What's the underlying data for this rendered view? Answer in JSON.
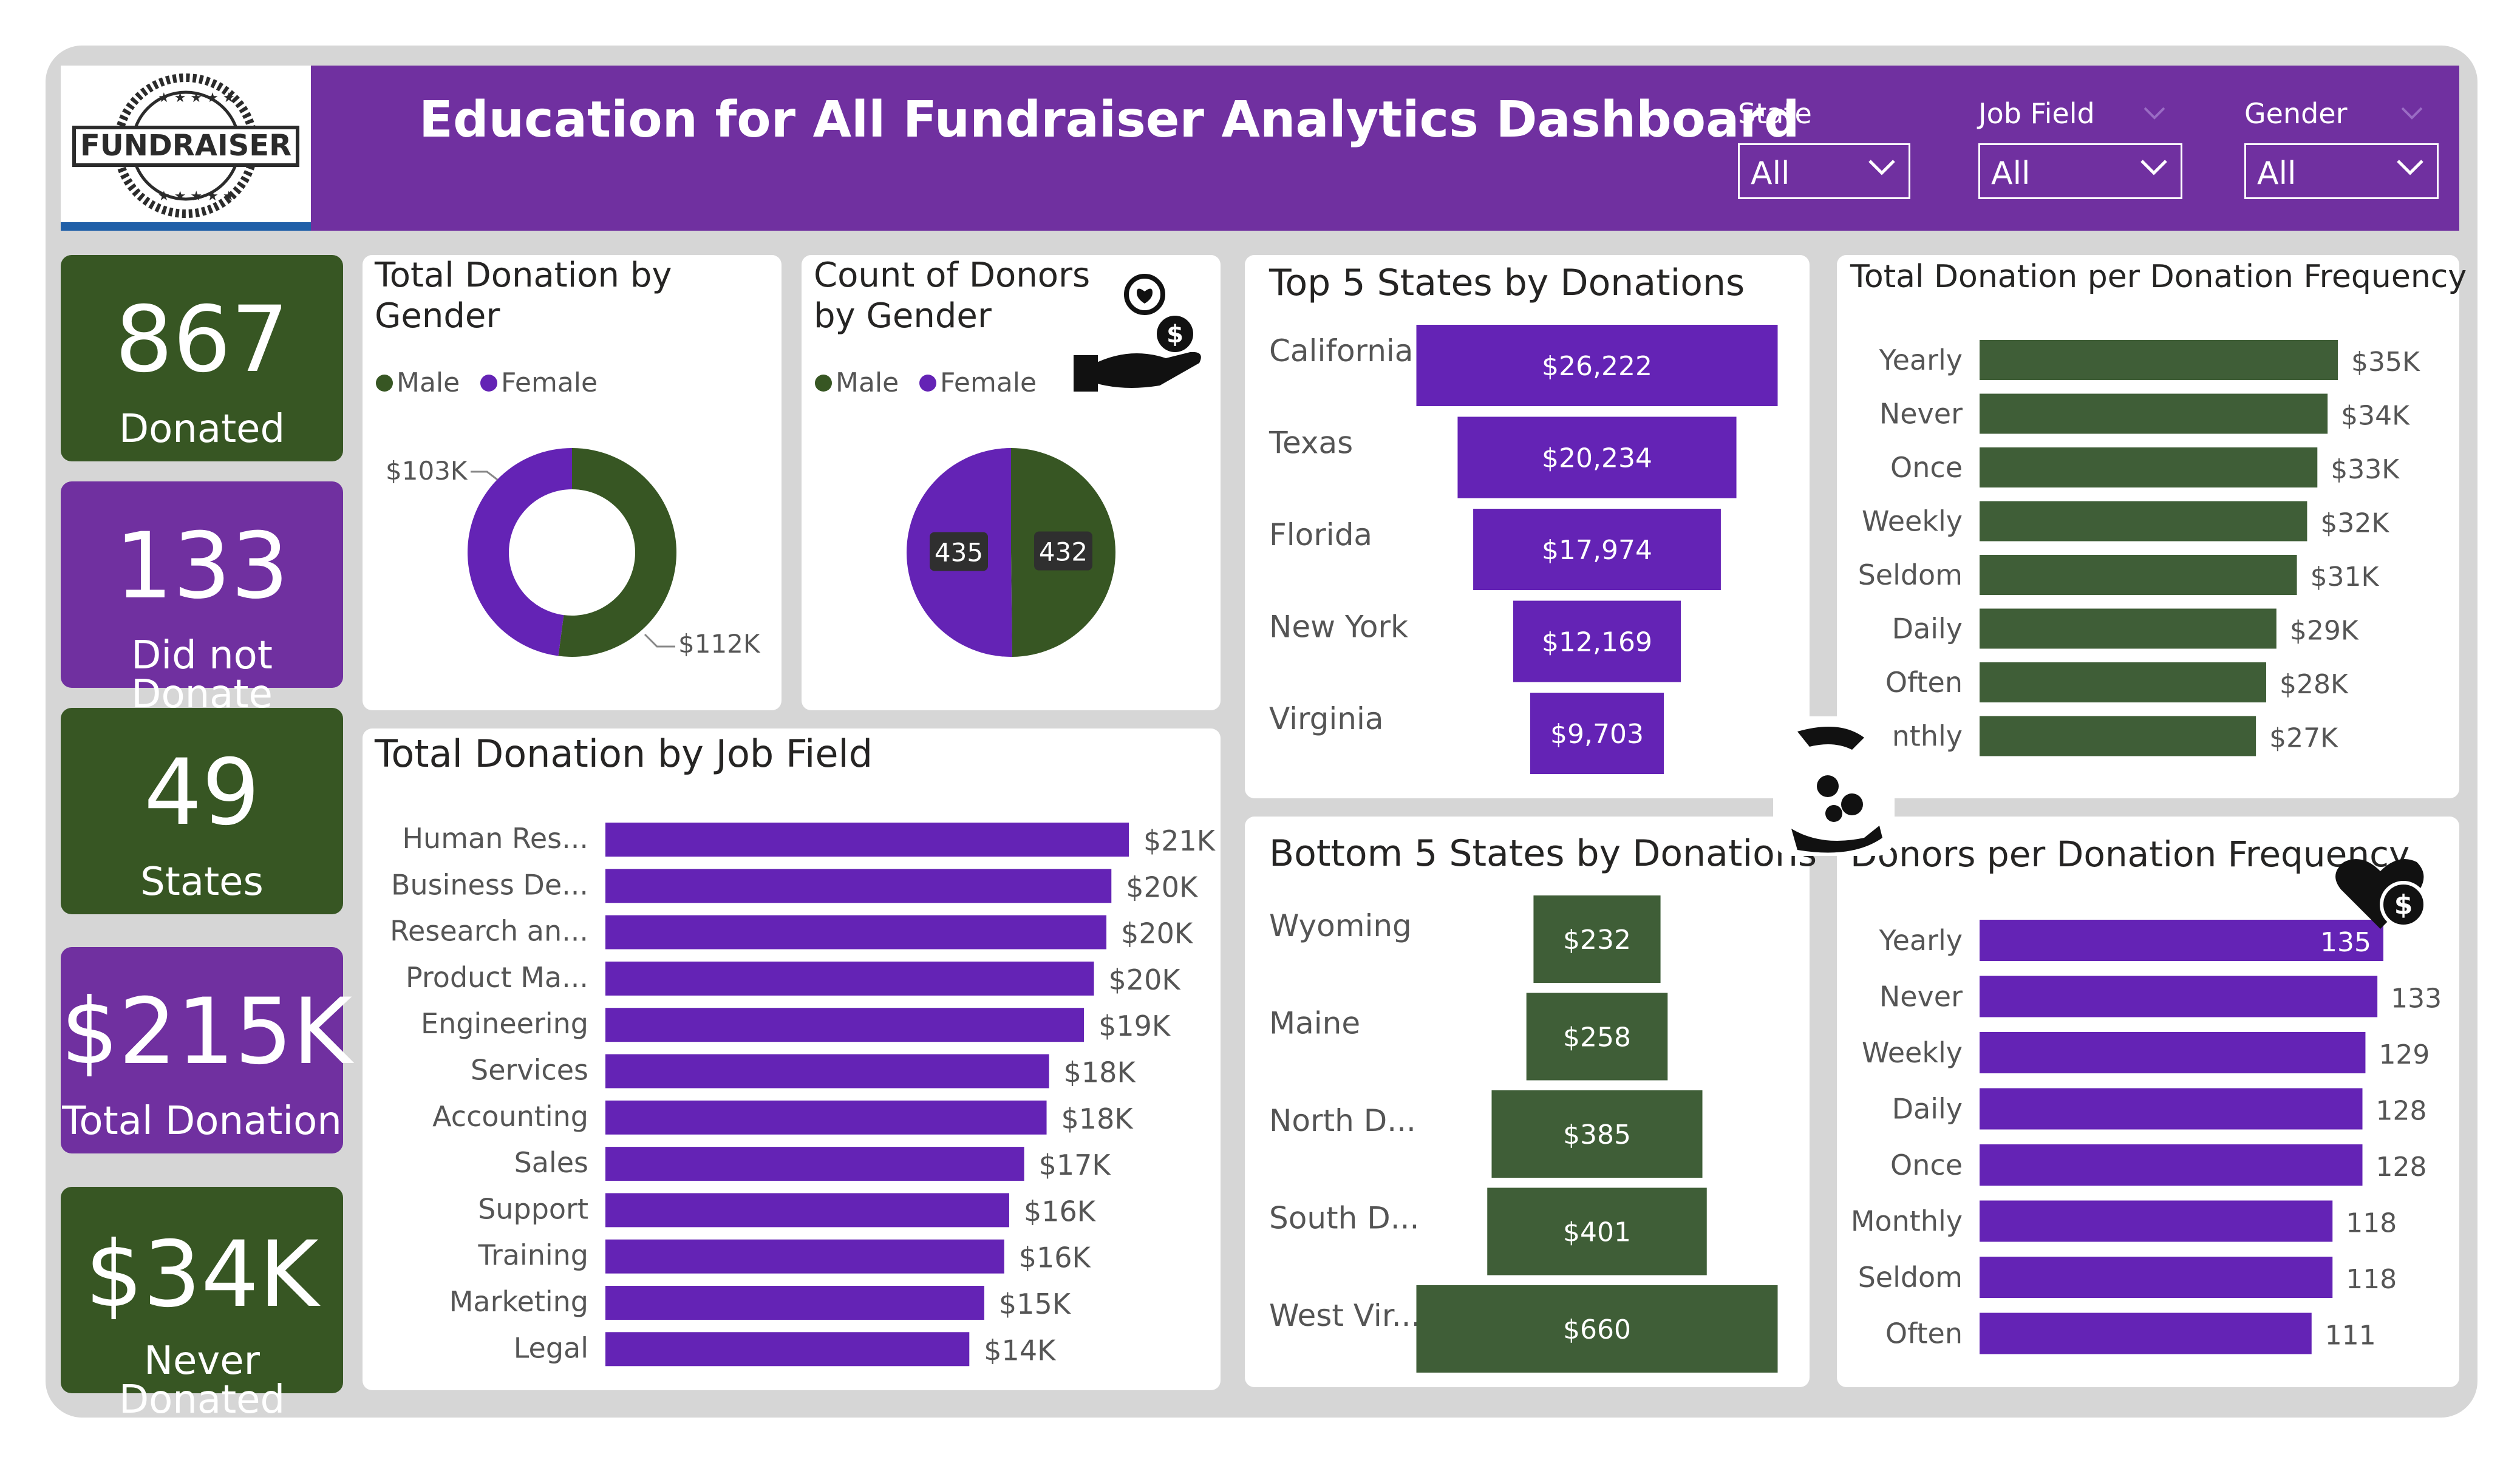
{
  "header": {
    "title": "Education for All Fundraiser Analytics Dashboard",
    "logo_text": "FUNDRAISER",
    "slicers": [
      {
        "label": "State",
        "value": "All"
      },
      {
        "label": "Job Field",
        "value": "All"
      },
      {
        "label": "Gender",
        "value": "All"
      }
    ]
  },
  "kpis": [
    {
      "value": "867",
      "label": "Donated"
    },
    {
      "value": "133",
      "label": "Did not Donate"
    },
    {
      "value": "49",
      "label": "States"
    },
    {
      "value": "$215K",
      "label": "Total Donation"
    },
    {
      "value": "$34K",
      "label": "Never Donated"
    }
  ],
  "icons": [
    "hand-donation-icon",
    "money-hand-icon",
    "heart-dollar-icon"
  ],
  "colors": {
    "purple": "#7030a0",
    "bar_purple": "#6423b5",
    "green": "#375623",
    "bar_green": "#3f5e37"
  },
  "chart_data": [
    {
      "type": "pie",
      "title": "Total Donation by Gender",
      "legend": [
        "Male",
        "Female"
      ],
      "legend_position": "top-left",
      "donut": true,
      "series": [
        {
          "name": "Male",
          "value": 112,
          "label": "$112K"
        },
        {
          "name": "Female",
          "value": 103,
          "label": "$103K"
        }
      ]
    },
    {
      "type": "pie",
      "title": "Count of Donors by Gender",
      "legend": [
        "Male",
        "Female"
      ],
      "legend_position": "top-left",
      "series": [
        {
          "name": "Male",
          "value": 432,
          "label": "432"
        },
        {
          "name": "Female",
          "value": 435,
          "label": "435"
        }
      ]
    },
    {
      "type": "bar",
      "orientation": "horizontal",
      "title": "Total Donation by Job Field",
      "categories": [
        "Human Res...",
        "Business De...",
        "Research an...",
        "Product Ma...",
        "Engineering",
        "Services",
        "Accounting",
        "Sales",
        "Support",
        "Training",
        "Marketing",
        "Legal"
      ],
      "values": [
        21,
        20.3,
        20.1,
        19.6,
        19.2,
        17.8,
        17.7,
        16.8,
        16.2,
        16.0,
        15.2,
        14.6
      ],
      "labels": [
        "$21K",
        "$20K",
        "$20K",
        "$20K",
        "$19K",
        "$18K",
        "$18K",
        "$17K",
        "$16K",
        "$16K",
        "$15K",
        "$14K"
      ]
    },
    {
      "type": "bar",
      "orientation": "funnel",
      "title": "Top 5 States by Donations",
      "categories": [
        "California",
        "Texas",
        "Florida",
        "New York",
        "Virginia"
      ],
      "values": [
        26222,
        20234,
        17974,
        12169,
        9703
      ],
      "labels": [
        "$26,222",
        "$20,234",
        "$17,974",
        "$12,169",
        "$9,703"
      ]
    },
    {
      "type": "bar",
      "orientation": "funnel",
      "title": "Bottom 5 States by Donations",
      "categories": [
        "Wyoming",
        "Maine",
        "North D...",
        "South D...",
        "West Vir..."
      ],
      "values": [
        232,
        258,
        385,
        401,
        660
      ],
      "labels": [
        "$232",
        "$258",
        "$385",
        "$401",
        "$660"
      ]
    },
    {
      "type": "bar",
      "orientation": "horizontal",
      "title": "Total Donation per Donation Frequency",
      "categories": [
        "Yearly",
        "Never",
        "Once",
        "Weekly",
        "Seldom",
        "Daily",
        "Often",
        "Monthly"
      ],
      "values": [
        35,
        34,
        33,
        32,
        31,
        29,
        28,
        27
      ],
      "labels": [
        "$35K",
        "$34K",
        "$33K",
        "$32K",
        "$31K",
        "$29K",
        "$28K",
        "$27K"
      ]
    },
    {
      "type": "bar",
      "orientation": "horizontal",
      "title": "Donors per Donation Frequency",
      "categories": [
        "Yearly",
        "Never",
        "Weekly",
        "Daily",
        "Once",
        "Monthly",
        "Seldom",
        "Often"
      ],
      "values": [
        135,
        133,
        129,
        128,
        128,
        118,
        118,
        111
      ],
      "labels": [
        "135",
        "133",
        "129",
        "128",
        "128",
        "118",
        "118",
        "111"
      ]
    }
  ]
}
